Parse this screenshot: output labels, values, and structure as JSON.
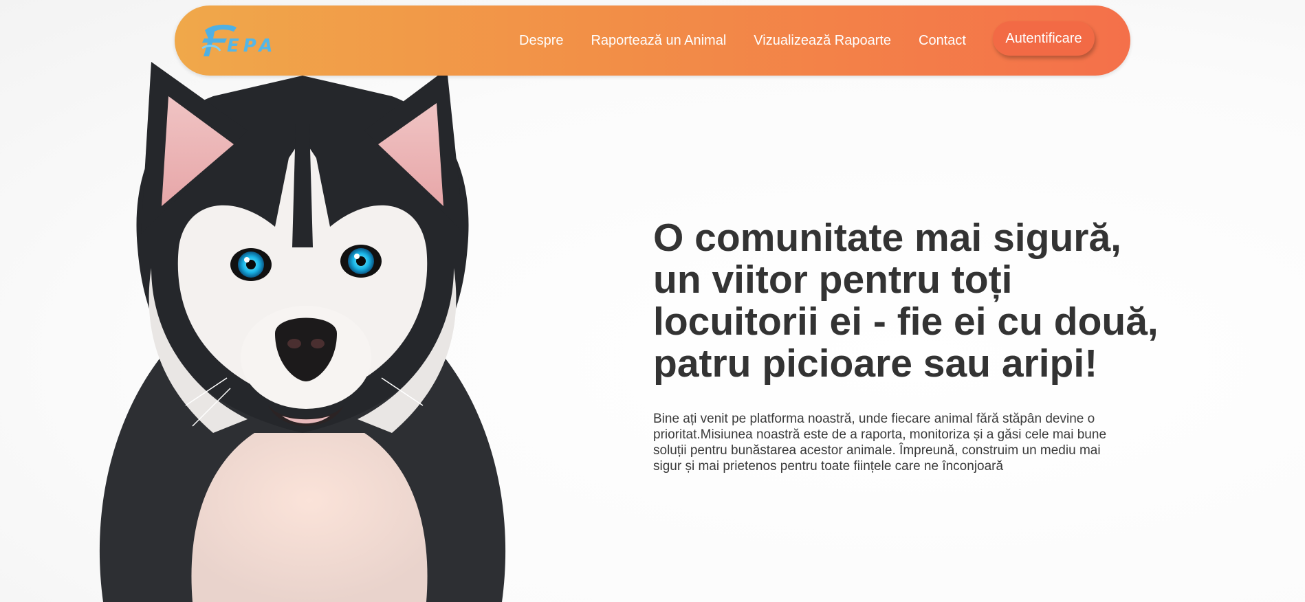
{
  "brand": {
    "logo_text": "EPA",
    "logo_icon": "stylized-f-logo-icon"
  },
  "nav": {
    "links": [
      "Despre",
      "Raportează un Animal",
      "Vizualizează Rapoarte",
      "Contact"
    ],
    "login_label": "Autentificare"
  },
  "hero": {
    "title": "O comunitate mai sigură,\nun viitor pentru toți\nlocuitorii ei - fie ei cu două,\npatru picioare sau aripi!",
    "description": "Bine ați venit pe platforma noastră, unde fiecare animal fără stăpân devine o prioritat.Misiunea noastră este de a raporta, monitoriza și a găsi cele mai bune soluții pentru bunăstarea acestor animale. Împreună, construim un mediu mai sigur și mai prietenos pentru toate ființele care ne înconjoară",
    "image": "husky-dog-portrait"
  },
  "colors": {
    "nav_gradient_start": "#f0a84a",
    "nav_gradient_end": "#f4704a",
    "login_button": "#f26a45",
    "logo_blue": "#55b6e6",
    "heading_text": "#333333"
  }
}
